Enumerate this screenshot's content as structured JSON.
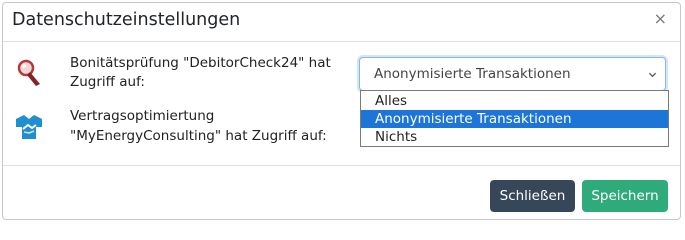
{
  "dialog": {
    "title": "Datenschutzeinstellungen",
    "close_glyph": "×"
  },
  "rows": [
    {
      "icon": "magnifier-icon",
      "label_line1": "Bonitätsprüfung \"DebitorCheck24\" hat",
      "label_line2": "Zugriff auf:"
    },
    {
      "icon": "handshake-icon",
      "label_line1": "Vertragsoptimiertung",
      "label_line2": "\"MyEnergyConsulting\" hat Zugriff auf:"
    }
  ],
  "select": {
    "value": "Anonymisierte Transaktionen",
    "options": [
      "Alles",
      "Anonymisierte Transaktionen",
      "Nichts"
    ],
    "selected_index": 1
  },
  "footer": {
    "close_label": "Schließen",
    "save_label": "Speichern"
  },
  "colors": {
    "close_button": "#36475a",
    "save_button": "#2eaa7b",
    "selected_option": "#1e75d8"
  }
}
